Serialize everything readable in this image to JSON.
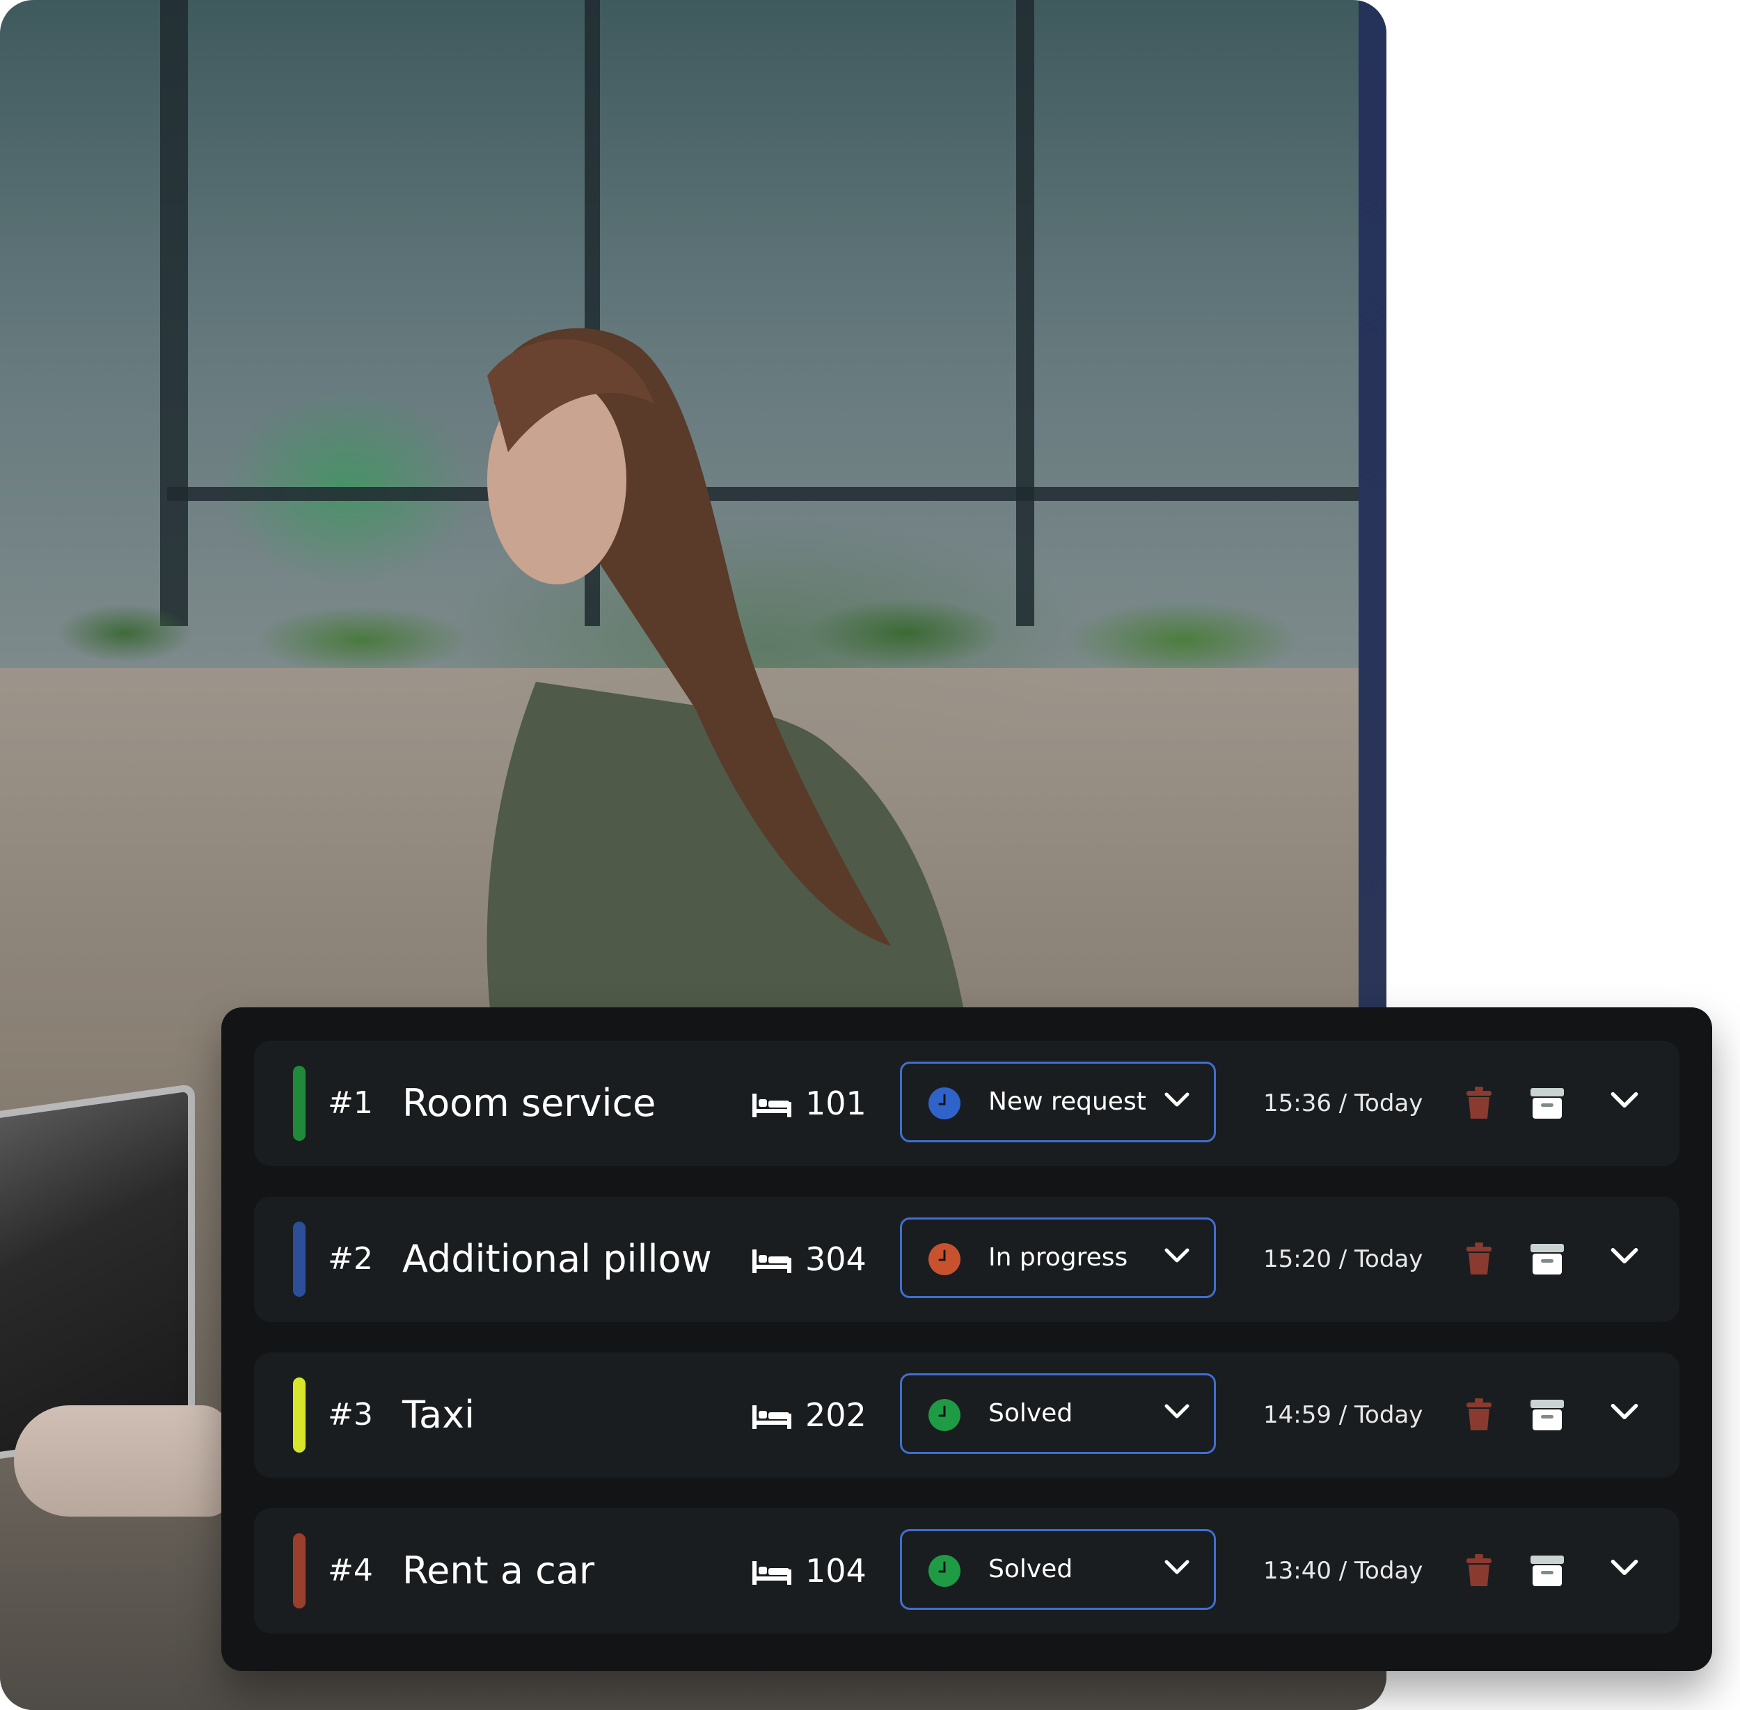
{
  "requests": [
    {
      "number": "#1",
      "title": "Room service",
      "room": "101",
      "status": "New request",
      "status_color": "#2f63c9",
      "time": "15:36 / Today",
      "accent": "#1e8a3a"
    },
    {
      "number": "#2",
      "title": "Additional pillow",
      "room": "304",
      "status": "In progress",
      "status_color": "#c9522e",
      "time": "15:20 / Today",
      "accent": "#2d4f9a"
    },
    {
      "number": "#3",
      "title": "Taxi",
      "room": "202",
      "status": "Solved",
      "status_color": "#1f9a45",
      "time": "14:59 / Today",
      "accent": "#d9e52a"
    },
    {
      "number": "#4",
      "title": "Rent a car",
      "room": "104",
      "status": "Solved",
      "status_color": "#1f9a45",
      "time": "13:40 / Today",
      "accent": "#9a3f2c"
    }
  ],
  "colors": {
    "panel_bg": "#121416",
    "row_bg": "#1a1d20",
    "status_border": "#3f6fd0",
    "trash": "#8a3a2e",
    "archive": "#c9d4d2"
  },
  "icons": {
    "room": "bed-icon",
    "status": "clock-icon",
    "status_toggle": "chevron-down-icon",
    "delete": "trash-icon",
    "archive": "archive-icon",
    "expand": "chevron-down-icon"
  }
}
